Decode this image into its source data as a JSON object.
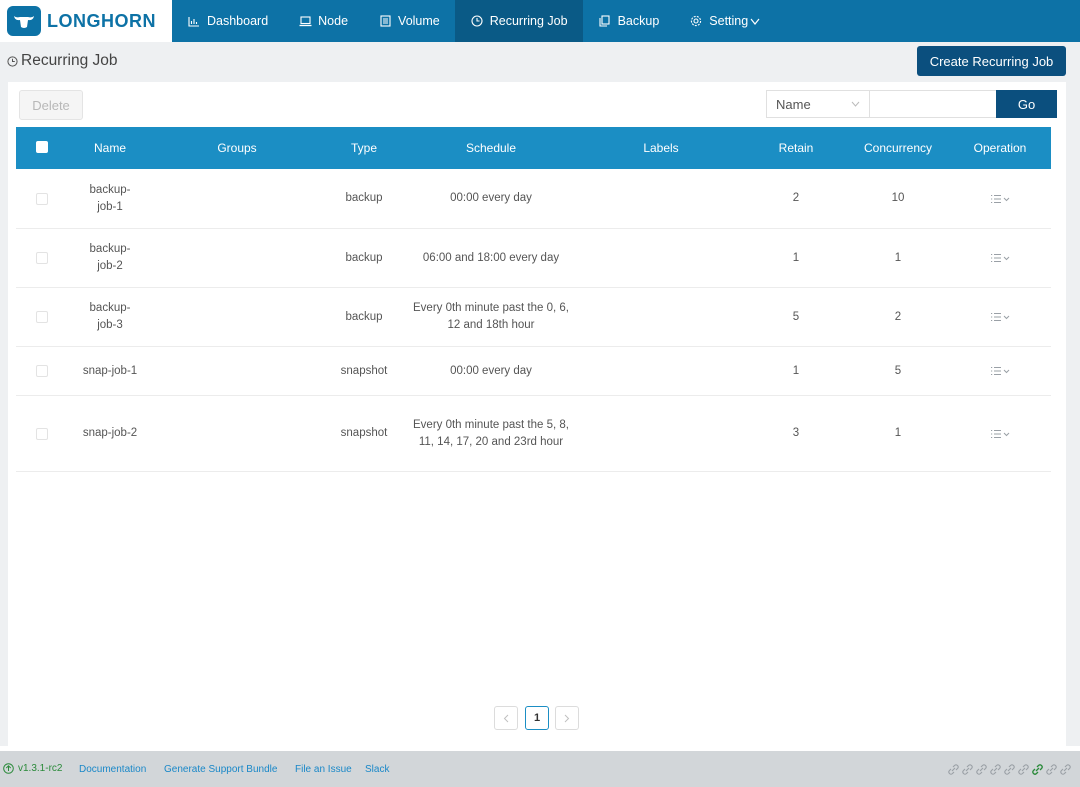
{
  "app": {
    "logo_text": "LONGHORN"
  },
  "nav": [
    {
      "label": "Dashboard",
      "icon": "chart-icon",
      "active": false
    },
    {
      "label": "Node",
      "icon": "laptop-icon",
      "active": false
    },
    {
      "label": "Volume",
      "icon": "list-icon",
      "active": false
    },
    {
      "label": "Recurring Job",
      "icon": "clock-icon",
      "active": true
    },
    {
      "label": "Backup",
      "icon": "copy-icon",
      "active": false
    },
    {
      "label": "Setting",
      "icon": "gear-icon",
      "active": false
    }
  ],
  "page": {
    "title": "Recurring Job",
    "create_label": "Create Recurring Job",
    "delete_label": "Delete",
    "search_field": "Name",
    "search_value": "",
    "go_label": "Go"
  },
  "table": {
    "columns": [
      "Name",
      "Groups",
      "Type",
      "Schedule",
      "Labels",
      "Retain",
      "Concurrency",
      "Operation"
    ],
    "rows": [
      {
        "name": "backup-\njob-1",
        "groups": "",
        "type": "backup",
        "schedule": "00:00 every day",
        "labels": "",
        "retain": "2",
        "concurrency": "10"
      },
      {
        "name": "backup-\njob-2",
        "groups": "",
        "type": "backup",
        "schedule": "06:00 and 18:00 every day",
        "labels": "",
        "retain": "1",
        "concurrency": "1"
      },
      {
        "name": "backup-\njob-3",
        "groups": "",
        "type": "backup",
        "schedule": "Every 0th minute past the 0, 6, 12 and 18th hour",
        "labels": "",
        "retain": "5",
        "concurrency": "2"
      },
      {
        "name": "snap-job-1",
        "groups": "",
        "type": "snapshot",
        "schedule": "00:00 every day",
        "labels": "",
        "retain": "1",
        "concurrency": "5"
      },
      {
        "name": "snap-job-2",
        "groups": "",
        "type": "snapshot",
        "schedule": "Every 0th minute past the 5, 8, 11, 14, 17, 20 and 23rd hour",
        "labels": "",
        "retain": "3",
        "concurrency": "1"
      }
    ]
  },
  "pagination": {
    "current": "1",
    "prev": "<",
    "next": ">"
  },
  "footer": {
    "version": "v1.3.1-rc2",
    "links": [
      "Documentation",
      "Generate Support Bundle",
      "File an Issue",
      "Slack"
    ]
  },
  "colors": {
    "nav_bg": "#0d72a6",
    "nav_active": "#0a5a86",
    "header_blue": "#1b8ec4",
    "button_dark": "#0b4f7e",
    "footer_bg": "#d2d6d9"
  }
}
